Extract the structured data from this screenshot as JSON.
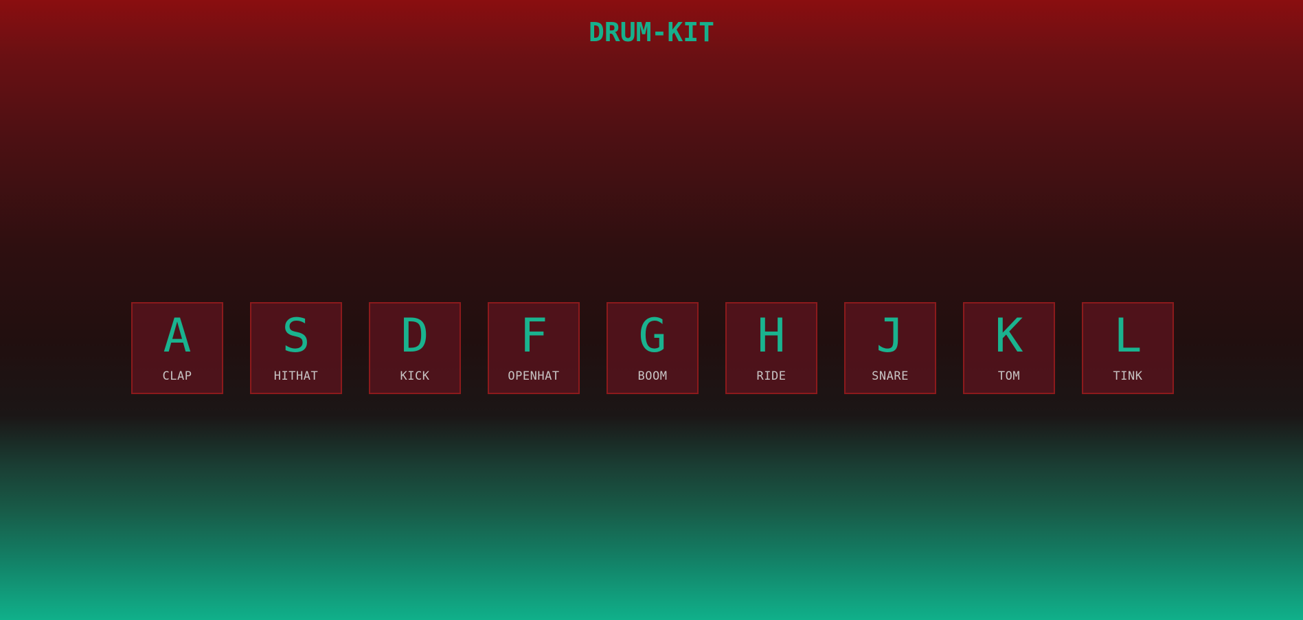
{
  "title": "DRUM-KIT",
  "colors": {
    "accent": "#17b08c",
    "key_border": "#8c1a1c",
    "label": "#c8c4c4",
    "bg_top": "#8a0e10",
    "bg_bottom": "#10b08a"
  },
  "keys": [
    {
      "letter": "A",
      "sound": "CLAP"
    },
    {
      "letter": "S",
      "sound": "HITHAT"
    },
    {
      "letter": "D",
      "sound": "KICK"
    },
    {
      "letter": "F",
      "sound": "OPENHAT"
    },
    {
      "letter": "G",
      "sound": "BOOM"
    },
    {
      "letter": "H",
      "sound": "RIDE"
    },
    {
      "letter": "J",
      "sound": "SNARE"
    },
    {
      "letter": "K",
      "sound": "TOM"
    },
    {
      "letter": "L",
      "sound": "TINK"
    }
  ]
}
